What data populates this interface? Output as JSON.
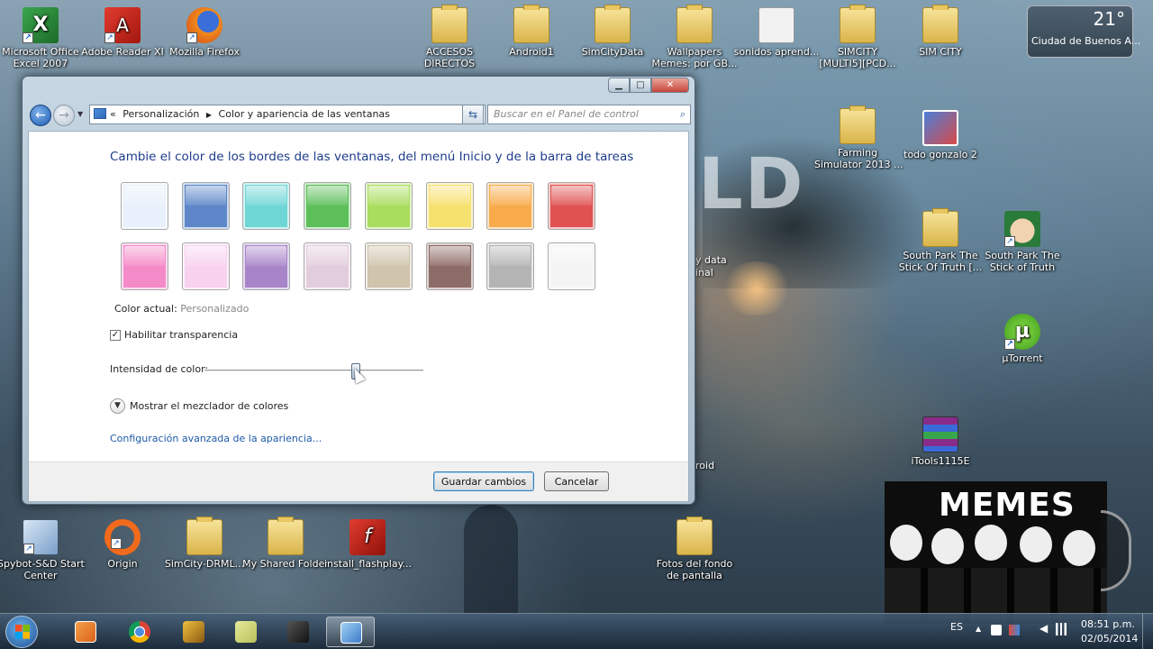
{
  "desktop": {
    "icons": [
      {
        "label": "Microsoft Office\nExcel 2007"
      },
      {
        "label": "Adobe Reader XI"
      },
      {
        "label": "Mozilla Firefox"
      },
      {
        "label": "ACCESOS\nDIRECTOS"
      },
      {
        "label": "Android1"
      },
      {
        "label": "SimCityData"
      },
      {
        "label": "Wallpapers\nMemes: por GB..."
      },
      {
        "label": "sonidos aprend..."
      },
      {
        "label": "SIMCITY\n[MULTI5][PCD..."
      },
      {
        "label": "SIM CITY"
      },
      {
        "label": "Farming\nSimulator 2013 ..."
      },
      {
        "label": "todo gonzalo 2"
      },
      {
        "label": "South Park The\nStick Of Truth [..."
      },
      {
        "label": "South Park The\nStick of Truth"
      },
      {
        "label": "µTorrent"
      },
      {
        "label": "iTools1115E"
      },
      {
        "label": "Spybot-S&D Start\nCenter"
      },
      {
        "label": "Origin"
      },
      {
        "label": "SimCity-DRML..."
      },
      {
        "label": "My Shared Folder"
      },
      {
        "label": "install_flashplay..."
      },
      {
        "label": "Fotos del fondo\nde pantalla"
      }
    ],
    "partial_labels": [
      "y data",
      "inal",
      "roid"
    ]
  },
  "weather": {
    "temp": "21°",
    "city": "Ciudad de Buenos A..."
  },
  "memes": {
    "title": "MEMES"
  },
  "window": {
    "caption": {
      "min": "▁",
      "max": "□",
      "close": "✕"
    },
    "address": {
      "chevron": "«",
      "crumb1": "Personalización",
      "sep": "▶",
      "crumb2": "Color y apariencia de las ventanas"
    },
    "search_placeholder": "Buscar en el Panel de control",
    "heading": "Cambie el color de los bordes de las ventanas, del menú Inicio y de la barra de tareas",
    "swatch_colors": [
      "#e7f0fb",
      "#5d87c9",
      "#6fd6d6",
      "#5cbf5a",
      "#a9dd5e",
      "#f6e06e",
      "#f8ab4a",
      "#e05252",
      "#f58ac9",
      "#f8d1ef",
      "#a884c9",
      "#e2cddc",
      "#cfc4ac",
      "#8d6b67",
      "#b4b4b4",
      "#f4f4f4"
    ],
    "current_color_label": "Color actual:",
    "current_color_value": "Personalizado",
    "transparency_label": "Habilitar transparencia",
    "transparency_checked": true,
    "intensity_label": "Intensidad de color:",
    "intensity_value": 0.7,
    "mixer_label": "Mostrar el mezclador de colores",
    "advanced_link": "Configuración avanzada de la apariencia...",
    "save_button": "Guardar cambios",
    "cancel_button": "Cancelar",
    "accent_color": "#1e5aa8"
  },
  "taskbar": {
    "lang": "ES",
    "time": "08:51 p.m.",
    "date": "02/05/2014"
  }
}
